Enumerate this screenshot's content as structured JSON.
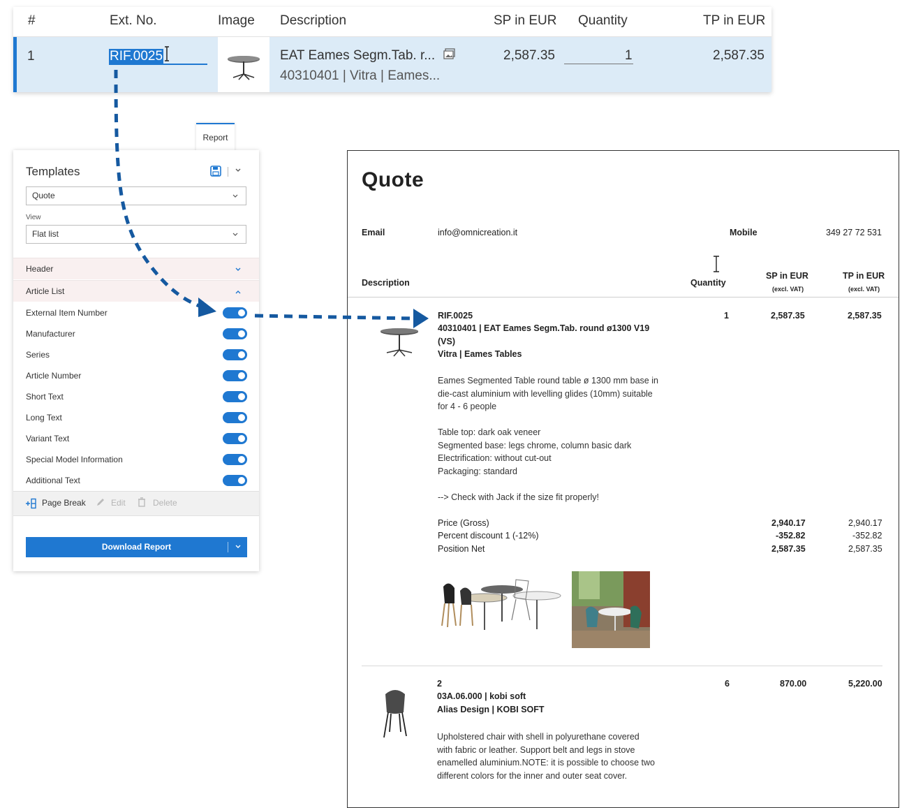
{
  "grid": {
    "columns": [
      "#",
      "Ext. No.",
      "Image",
      "Description",
      "SP in EUR",
      "Quantity",
      "TP in EUR"
    ],
    "row": {
      "index": "1",
      "ext_no": "RIF.0025",
      "description_line1": "EAT Eames Segm.Tab. r...",
      "description_line2": "40310401 | Vitra | Eames...",
      "sp": "2,587.35",
      "quantity": "1",
      "tp": "2,587.35"
    }
  },
  "panel": {
    "tab_label": "Report",
    "title": "Templates",
    "template_select": "Quote",
    "view_label": "View",
    "view_select": "Flat list",
    "sections": {
      "header": "Header",
      "article_list": "Article List"
    },
    "options": [
      "External Item Number",
      "Manufacturer",
      "Series",
      "Article Number",
      "Short Text",
      "Long Text",
      "Variant Text",
      "Special Model Information",
      "Additional Text"
    ],
    "toolbar": {
      "page_break": "Page Break",
      "edit": "Edit",
      "delete": "Delete"
    },
    "download": "Download Report",
    "accent": "#1f78d1"
  },
  "doc": {
    "title": "Quote",
    "email_label": "Email",
    "email_value": "info@omnicreation.it",
    "mobile_label": "Mobile",
    "mobile_value": "349 27 72 531",
    "headers": {
      "description": "Description",
      "quantity": "Quantity",
      "sp": "SP in EUR",
      "sp_sub": "(excl. VAT)",
      "tp": "TP in EUR",
      "tp_sub": "(excl. VAT)"
    },
    "item1": {
      "ext_no": "RIF.0025",
      "title_line1": "40310401 | EAT Eames Segm.Tab. round ø1300 V19",
      "title_line2": "(VS)",
      "brand": "Vitra | Eames Tables",
      "quantity": "1",
      "sp": "2,587.35",
      "tp": "2,587.35",
      "long_text": [
        "Eames Segmented Table round table ø 1300 mm base in",
        "die-cast aluminium with levelling glides (10mm) suitable",
        "for 4 - 6 people"
      ],
      "variants": [
        "Table top: dark oak veneer",
        "Segmented base: legs chrome, column basic dark",
        "Electrification: without cut-out",
        "Packaging: standard"
      ],
      "note": "--> Check with Jack if the size fit properly!",
      "price_rows": [
        {
          "label": "Price (Gross)",
          "sp": "2,940.17",
          "tp": "2,940.17"
        },
        {
          "label": "Percent discount 1 (-12%)",
          "sp": "-352.82",
          "tp": "-352.82"
        },
        {
          "label": "Position Net",
          "sp": "2,587.35",
          "tp": "2,587.35"
        }
      ]
    },
    "item2": {
      "index": "2",
      "title": "03A.06.000 | kobi soft",
      "brand": "Alias Design | KOBI SOFT",
      "quantity": "6",
      "sp": "870.00",
      "tp": "5,220.00",
      "long_text": [
        "Upholstered chair with shell in polyurethane covered",
        "with fabric or leather. Support belt and legs in stove",
        "enamelled aluminium.NOTE: it is possible to choose two",
        "different colors for the inner and outer seat cover."
      ]
    }
  }
}
